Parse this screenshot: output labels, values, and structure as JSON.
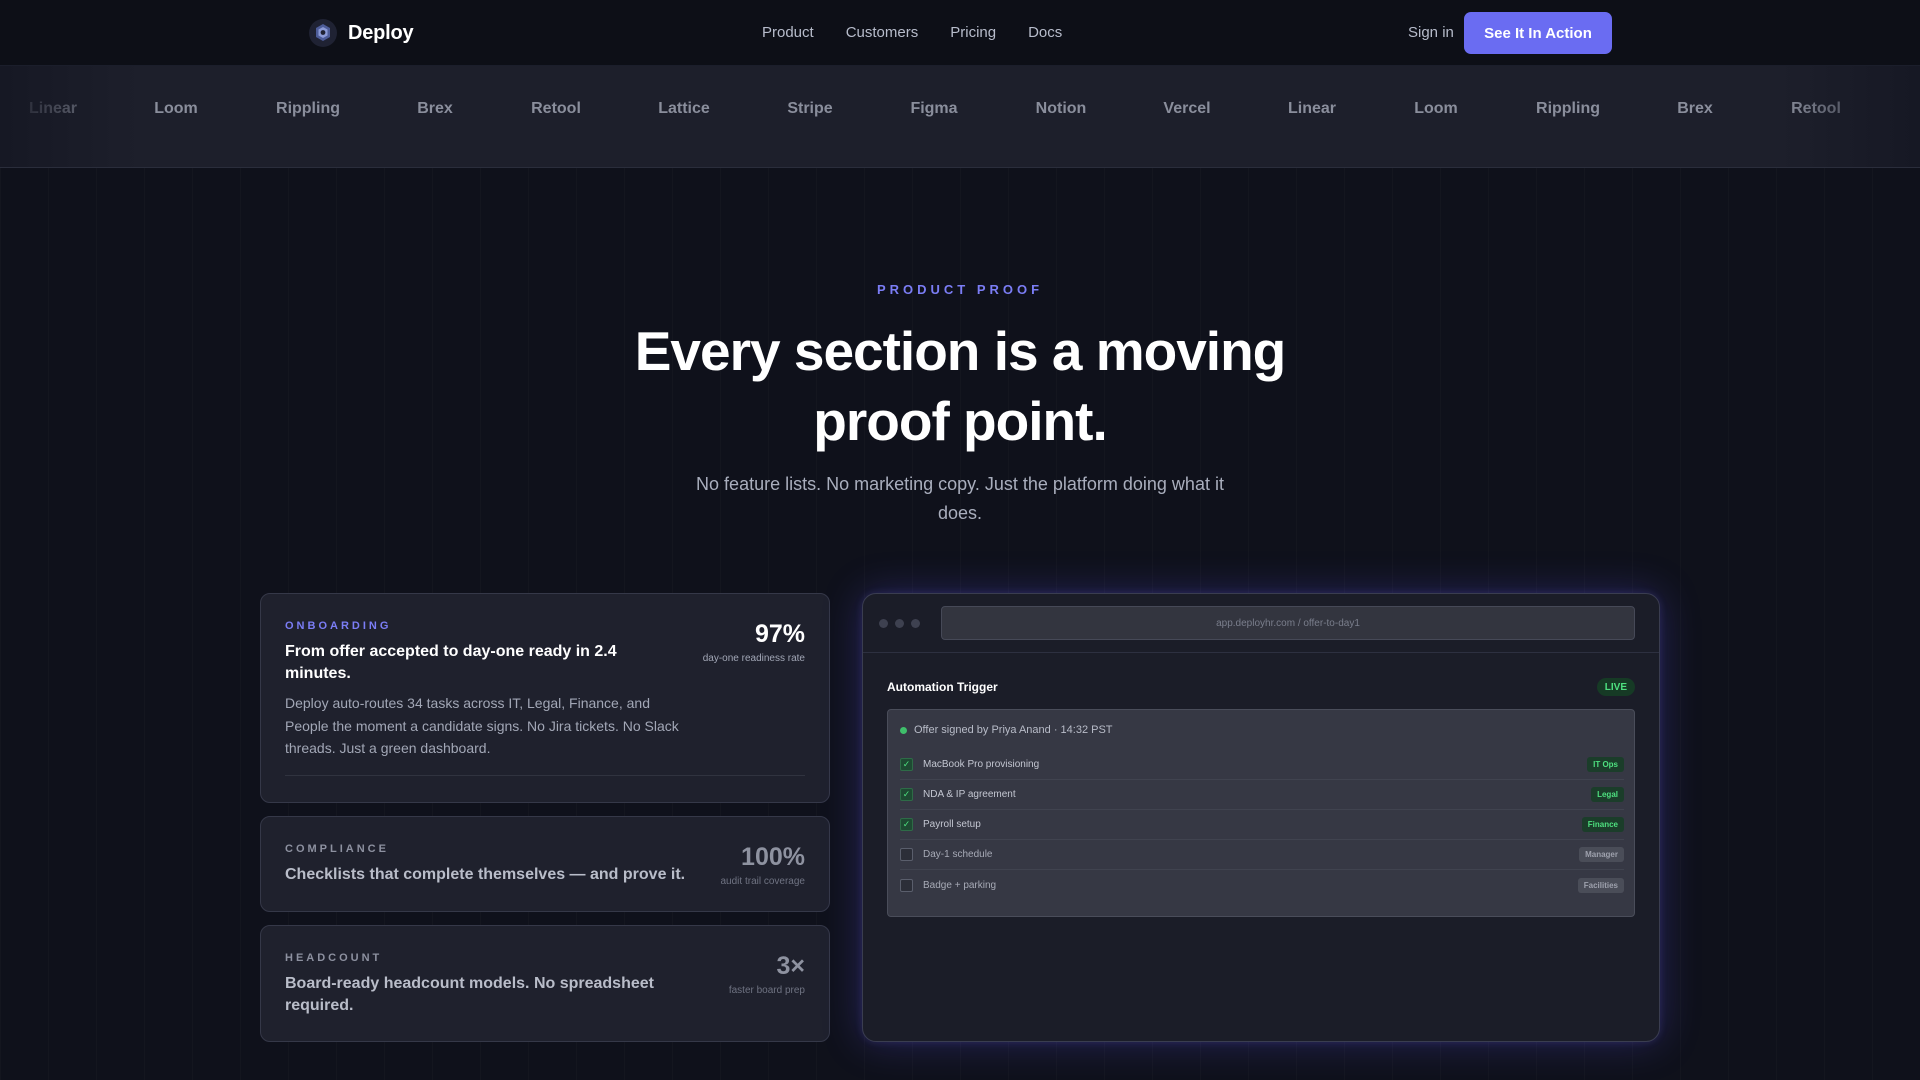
{
  "nav": {
    "brand": "Deploy",
    "links": [
      "Product",
      "Customers",
      "Pricing",
      "Docs"
    ],
    "signin": "Sign in",
    "cta": "See It In Action"
  },
  "logos": [
    "Linear",
    "Loom",
    "Rippling",
    "Brex",
    "Retool",
    "Lattice",
    "Stripe",
    "Figma",
    "Notion",
    "Vercel",
    "Linear",
    "Loom",
    "Rippling",
    "Brex",
    "Retool"
  ],
  "hero": {
    "eyebrow": "PRODUCT PROOF",
    "title_line1": "Every section is a moving",
    "title_line2": "proof point.",
    "subtitle": "No feature lists. No marketing copy. Just the platform doing what it does."
  },
  "cards": [
    {
      "tag": "ONBOARDING",
      "title": "From offer accepted to day-one ready in 2.4 minutes.",
      "body": "Deploy auto-routes 34 tasks across IT, Legal, Finance, and People the moment a candidate signs. No Jira tickets. No Slack threads. Just a green dashboard.",
      "metric": "97%",
      "metric_label": "day-one readiness rate"
    },
    {
      "tag": "COMPLIANCE",
      "title": "Checklists that complete themselves — and prove it.",
      "metric": "100%",
      "metric_label": "audit trail coverage"
    },
    {
      "tag": "HEADCOUNT",
      "title": "Board-ready headcount models. No spreadsheet required.",
      "metric": "3×",
      "metric_label": "faster board prep"
    }
  ],
  "demo": {
    "url": "app.deployhr.com / offer-to-day1",
    "title": "Automation Trigger",
    "live": "LIVE",
    "signed": "Offer signed by Priya Anand · 14:32 PST",
    "tasks": [
      {
        "label": "MacBook Pro provisioning",
        "tag": "IT Ops",
        "done": true
      },
      {
        "label": "NDA & IP agreement",
        "tag": "Legal",
        "done": true
      },
      {
        "label": "Payroll setup",
        "tag": "Finance",
        "done": true
      },
      {
        "label": "Day-1 schedule",
        "tag": "Manager",
        "done": false
      },
      {
        "label": "Badge + parking",
        "tag": "Facilities",
        "done": false
      }
    ],
    "colors": {
      "accent": "#6a6cf2",
      "success": "#4ee07f"
    }
  }
}
